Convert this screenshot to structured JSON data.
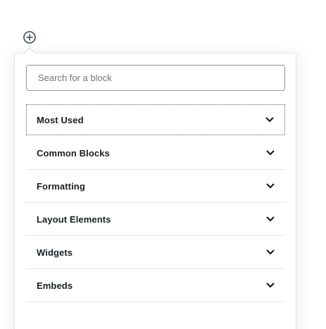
{
  "inserter": {
    "toggle_icon": "plus-circle-icon",
    "search": {
      "placeholder": "Search for a block",
      "value": ""
    },
    "panels": [
      {
        "label": "Most Used",
        "icon": "chevron-down-icon",
        "focused": true
      },
      {
        "label": "Common Blocks",
        "icon": "chevron-down-icon"
      },
      {
        "label": "Formatting",
        "icon": "chevron-down-icon"
      },
      {
        "label": "Layout Elements",
        "icon": "chevron-down-icon"
      },
      {
        "label": "Widgets",
        "icon": "chevron-down-icon"
      },
      {
        "label": "Embeds",
        "icon": "chevron-down-icon"
      }
    ]
  },
  "colors": {
    "text": "#191e23",
    "placeholder": "#6c7781",
    "border": "#8d96a0",
    "divider": "#e2e4e7",
    "icon": "#555d66"
  }
}
